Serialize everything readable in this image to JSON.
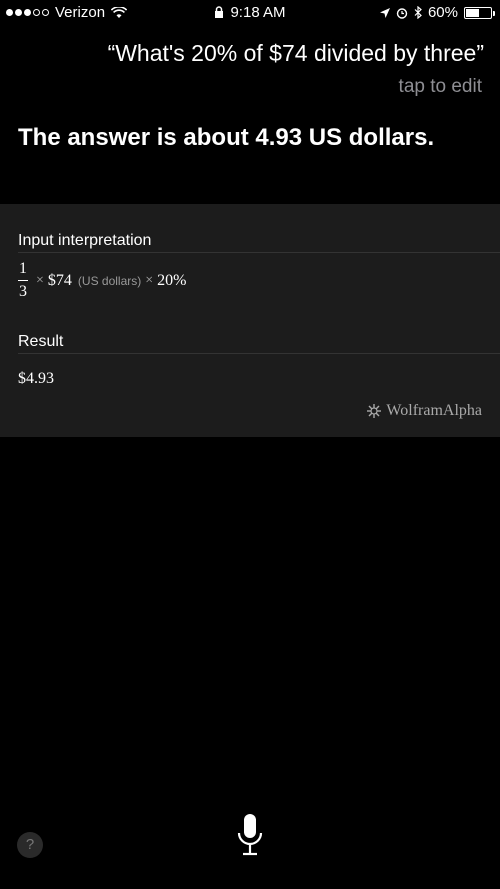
{
  "status_bar": {
    "carrier": "Verizon",
    "time": "9:18 AM",
    "battery": "60%",
    "battery_level": 0.6
  },
  "siri": {
    "query": "“What's 20% of $74 divided by three”",
    "tap_to_edit": "tap to edit",
    "answer": "The answer is about 4.93 US dollars."
  },
  "card": {
    "input_title": "Input interpretation",
    "fraction_numerator": "1",
    "fraction_denominator": "3",
    "times": "×",
    "amount": "$74",
    "unit": "(US dollars)",
    "percent": "20%",
    "result_title": "Result",
    "result_value": "$4.93",
    "brand": "WolframAlpha"
  },
  "icons": {
    "wifi": "wifi-icon",
    "lock": "lock-icon",
    "location": "location-icon",
    "alarm": "alarm-icon",
    "bluetooth": "bluetooth-icon",
    "battery": "battery-icon",
    "help": "help-icon",
    "microphone": "microphone-icon"
  },
  "help_label": "?"
}
